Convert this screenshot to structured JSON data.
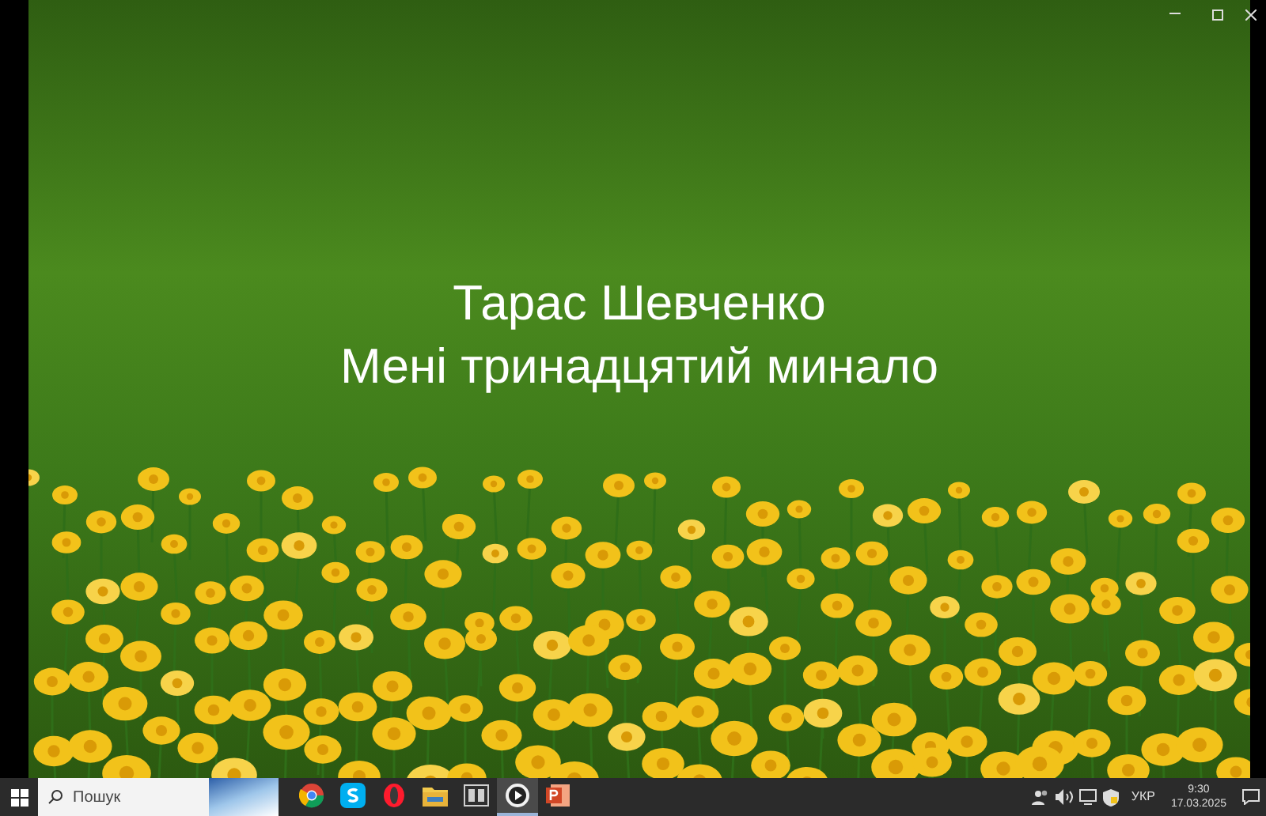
{
  "slide": {
    "lines": [
      "Тарас Шевченко",
      "Мені тринадцятий минало"
    ]
  },
  "taskbar": {
    "search": {
      "placeholder": "Пошук"
    },
    "apps": [
      {
        "kind": "browser-round",
        "selected": false
      },
      {
        "kind": "chat",
        "selected": false
      },
      {
        "kind": "browser-ring",
        "selected": false
      },
      {
        "kind": "folder",
        "selected": false
      },
      {
        "kind": "viewer",
        "selected": false
      },
      {
        "kind": "player",
        "selected": true
      },
      {
        "kind": "slides",
        "selected": false
      }
    ],
    "tray": {
      "language": "УКР",
      "time": "9:30",
      "date": "17.03.2025"
    }
  }
}
